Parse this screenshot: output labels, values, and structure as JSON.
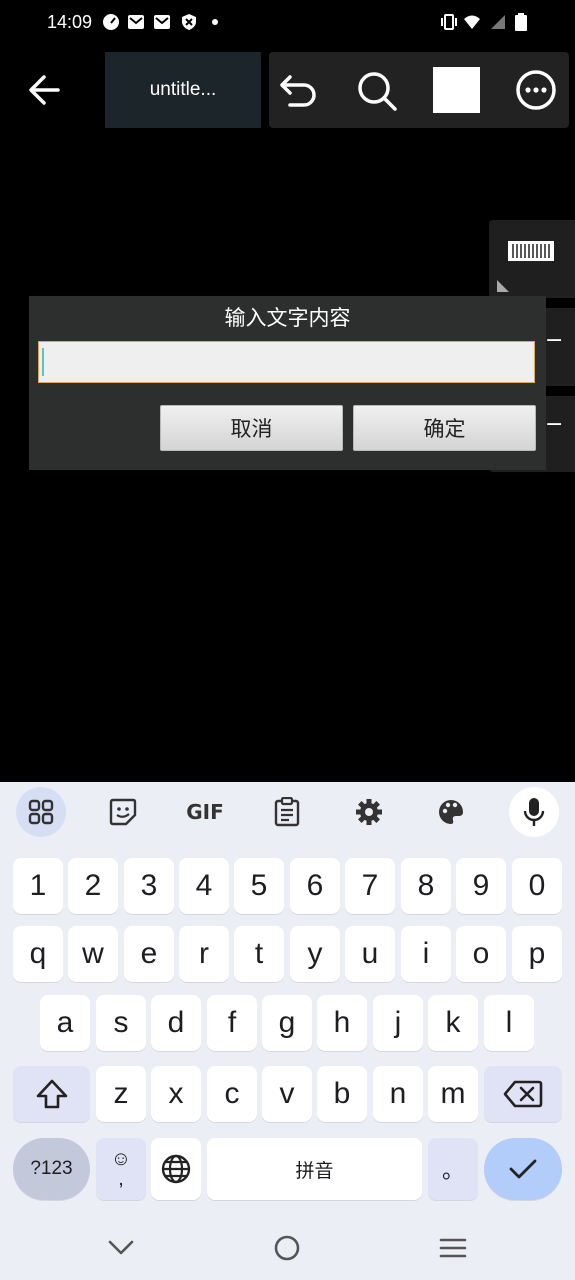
{
  "status_bar": {
    "time": "14:09",
    "left_icons": [
      "speedometer-icon",
      "mail-icon",
      "mail-icon",
      "shield-icon",
      "dot-icon"
    ],
    "right_icons": [
      "vibrate-icon",
      "wifi-icon",
      "signal-icon",
      "battery-icon"
    ]
  },
  "toolbar": {
    "tab_title": "untitle...",
    "color_swatch": "#ffffff"
  },
  "dialog": {
    "title": "输入文字内容",
    "input_value": "",
    "cancel_label": "取消",
    "ok_label": "确定"
  },
  "side_panel": {
    "tab2_label": "−",
    "tab3_label": "−"
  },
  "keyboard": {
    "toolbar_icons": [
      "apps-grid-icon",
      "sticker-icon",
      "gif-icon",
      "clipboard-icon",
      "settings-gear-icon",
      "palette-icon",
      "microphone-icon"
    ],
    "gif_label": "GIF",
    "row_numbers": [
      "1",
      "2",
      "3",
      "4",
      "5",
      "6",
      "7",
      "8",
      "9",
      "0"
    ],
    "row1": [
      "q",
      "w",
      "e",
      "r",
      "t",
      "y",
      "u",
      "i",
      "o",
      "p"
    ],
    "row2": [
      "a",
      "s",
      "d",
      "f",
      "g",
      "h",
      "j",
      "k",
      "l"
    ],
    "row3": [
      "z",
      "x",
      "c",
      "v",
      "b",
      "n",
      "m"
    ],
    "symbols_label": "?123",
    "emoji_top": "☺",
    "emoji_bottom": ",",
    "space_label": "拼音",
    "period_label": "。"
  },
  "colors": {
    "accent_blue": "#b3cdfa",
    "keyboard_bg": "#eceef5",
    "dialog_bg": "#2d2f2e"
  }
}
